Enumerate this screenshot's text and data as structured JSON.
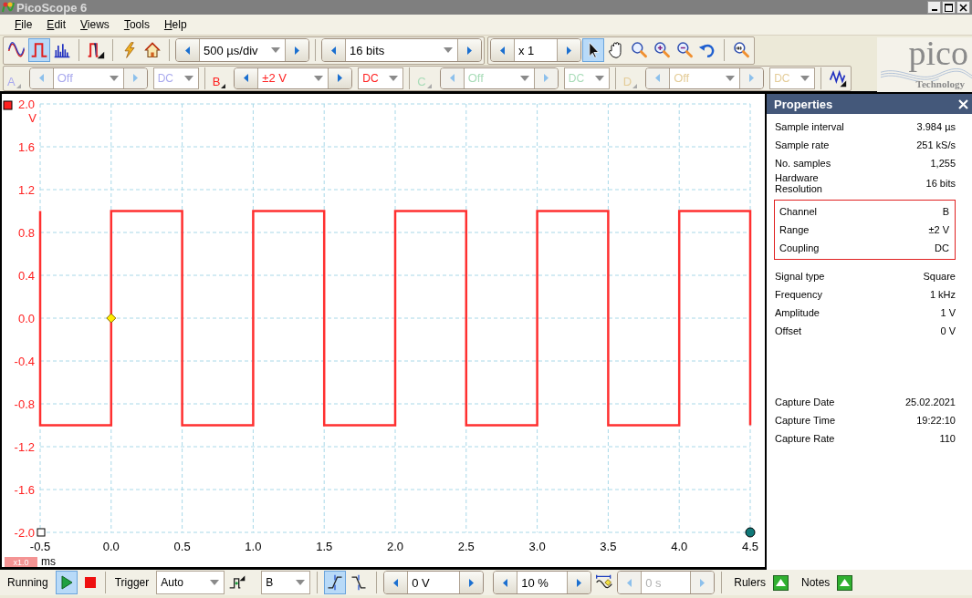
{
  "window": {
    "title": "PicoScope 6"
  },
  "menu": [
    {
      "label": "File"
    },
    {
      "label": "Edit"
    },
    {
      "label": "Views"
    },
    {
      "label": "Tools"
    },
    {
      "label": "Help"
    }
  ],
  "toolbar": {
    "modes": [
      {
        "kind": "scope",
        "selected": false
      },
      {
        "kind": "persistence",
        "selected": true
      },
      {
        "kind": "spectrum",
        "selected": false
      }
    ],
    "actions": [
      {
        "kind": "siggen"
      },
      {
        "kind": "lightning"
      },
      {
        "kind": "home"
      }
    ],
    "timebase": "500 µs/div",
    "resolution": "16 bits",
    "zoom": "x 1",
    "tools": [
      {
        "kind": "pointer",
        "selected": true
      },
      {
        "kind": "hand",
        "selected": false
      },
      {
        "kind": "zoom-area",
        "selected": false
      },
      {
        "kind": "zoom-in",
        "selected": false
      },
      {
        "kind": "zoom-out",
        "selected": false
      },
      {
        "kind": "undo",
        "selected": false
      },
      {
        "kind": "zoom-100",
        "selected": false
      }
    ]
  },
  "logo": {
    "name": "pico",
    "tagline": "Technology"
  },
  "channels": [
    {
      "name": "A",
      "enabled": false,
      "color": "#aaaaee",
      "range": "Off",
      "coupling": "DC"
    },
    {
      "name": "B",
      "enabled": true,
      "color": "#ff2020",
      "range": "±2 V",
      "coupling": "DC"
    },
    {
      "name": "C",
      "enabled": false,
      "color": "#a8dcb8",
      "range": "Off",
      "coupling": "DC"
    },
    {
      "name": "D",
      "enabled": false,
      "color": "#e4cc98",
      "range": "Off",
      "coupling": "DC"
    }
  ],
  "scope": {
    "y_unit": "V",
    "x_unit": "ms",
    "scale_badge": "x1.0",
    "chart_data": {
      "type": "line",
      "grid": true,
      "xlim": [
        -0.5,
        4.5
      ],
      "ylim": [
        -2,
        2
      ],
      "xticks": [
        {
          "value": -0.5,
          "label": "-0.5"
        },
        {
          "value": 0,
          "label": "0.0"
        },
        {
          "value": 0.5,
          "label": "0.5"
        },
        {
          "value": 1,
          "label": "1.0"
        },
        {
          "value": 1.5,
          "label": "1.5"
        },
        {
          "value": 2,
          "label": "2.0"
        },
        {
          "value": 2.5,
          "label": "2.5"
        },
        {
          "value": 3,
          "label": "3.0"
        },
        {
          "value": 3.5,
          "label": "3.5"
        },
        {
          "value": 4,
          "label": "4.0"
        },
        {
          "value": 4.5,
          "label": "4.5"
        }
      ],
      "yticks": [
        {
          "value": 2,
          "label": "2.0"
        },
        {
          "value": 1.6,
          "label": "1.6"
        },
        {
          "value": 1.2,
          "label": "1.2"
        },
        {
          "value": 0.8,
          "label": "0.8"
        },
        {
          "value": 0.4,
          "label": "0.4"
        },
        {
          "value": 0,
          "label": "0.0"
        },
        {
          "value": -0.4,
          "label": "-0.4"
        },
        {
          "value": -0.8,
          "label": "-0.8"
        },
        {
          "value": -1.2,
          "label": "-1.2"
        },
        {
          "value": -1.6,
          "label": "-1.6"
        },
        {
          "value": -2,
          "label": "-2.0"
        }
      ],
      "x": [
        -0.5,
        -0.5,
        0,
        0,
        0.5,
        0.5,
        1,
        1,
        1.5,
        1.5,
        2,
        2,
        2.5,
        2.5,
        3,
        3,
        3.5,
        3.5,
        4,
        4,
        4.5,
        4.5
      ],
      "series": [
        {
          "color": "#ff3030",
          "values": [
            1,
            -1,
            -1,
            1,
            1,
            -1,
            -1,
            1,
            1,
            -1,
            -1,
            1,
            1,
            -1,
            -1,
            1,
            1,
            -1,
            -1,
            1,
            1,
            -1
          ]
        }
      ]
    }
  },
  "properties": {
    "title": "Properties",
    "sections": [
      {
        "kind": "plain",
        "rows": [
          {
            "label": "Sample interval",
            "value": "3.984 µs"
          },
          {
            "label": "Sample rate",
            "value": "251 kS/s"
          },
          {
            "label": "No. samples",
            "value": "1,255"
          },
          {
            "label": "Hardware Resolution",
            "value": "16 bits"
          }
        ]
      },
      {
        "kind": "boxed",
        "rows": [
          {
            "label": "Channel",
            "value": "B"
          },
          {
            "label": "Range",
            "value": "±2 V"
          },
          {
            "label": "Coupling",
            "value": "DC"
          }
        ]
      },
      {
        "kind": "plain",
        "rows": [
          {
            "label": "Signal type",
            "value": "Square"
          },
          {
            "label": "Frequency",
            "value": "1 kHz"
          },
          {
            "label": "Amplitude",
            "value": "1 V"
          },
          {
            "label": "Offset",
            "value": "0 V"
          }
        ]
      },
      {
        "kind": "detached",
        "rows": [
          {
            "label": "Capture Date",
            "value": "25.02.2021"
          },
          {
            "label": "Capture Time",
            "value": "19:22:10"
          },
          {
            "label": "Capture Rate",
            "value": "110"
          }
        ]
      }
    ]
  },
  "status_bar": {
    "state": "Running",
    "running": true,
    "trigger_label": "Trigger",
    "trigger_mode": "Auto",
    "trigger_source": "B",
    "edges": [
      {
        "kind": "rising",
        "selected": true
      },
      {
        "kind": "falling",
        "selected": false
      }
    ],
    "trigger_level": "0 V",
    "pretrigger": "10 %",
    "delay": "0 s",
    "delay_enabled": false,
    "rulers_label": "Rulers",
    "notes_label": "Notes"
  }
}
